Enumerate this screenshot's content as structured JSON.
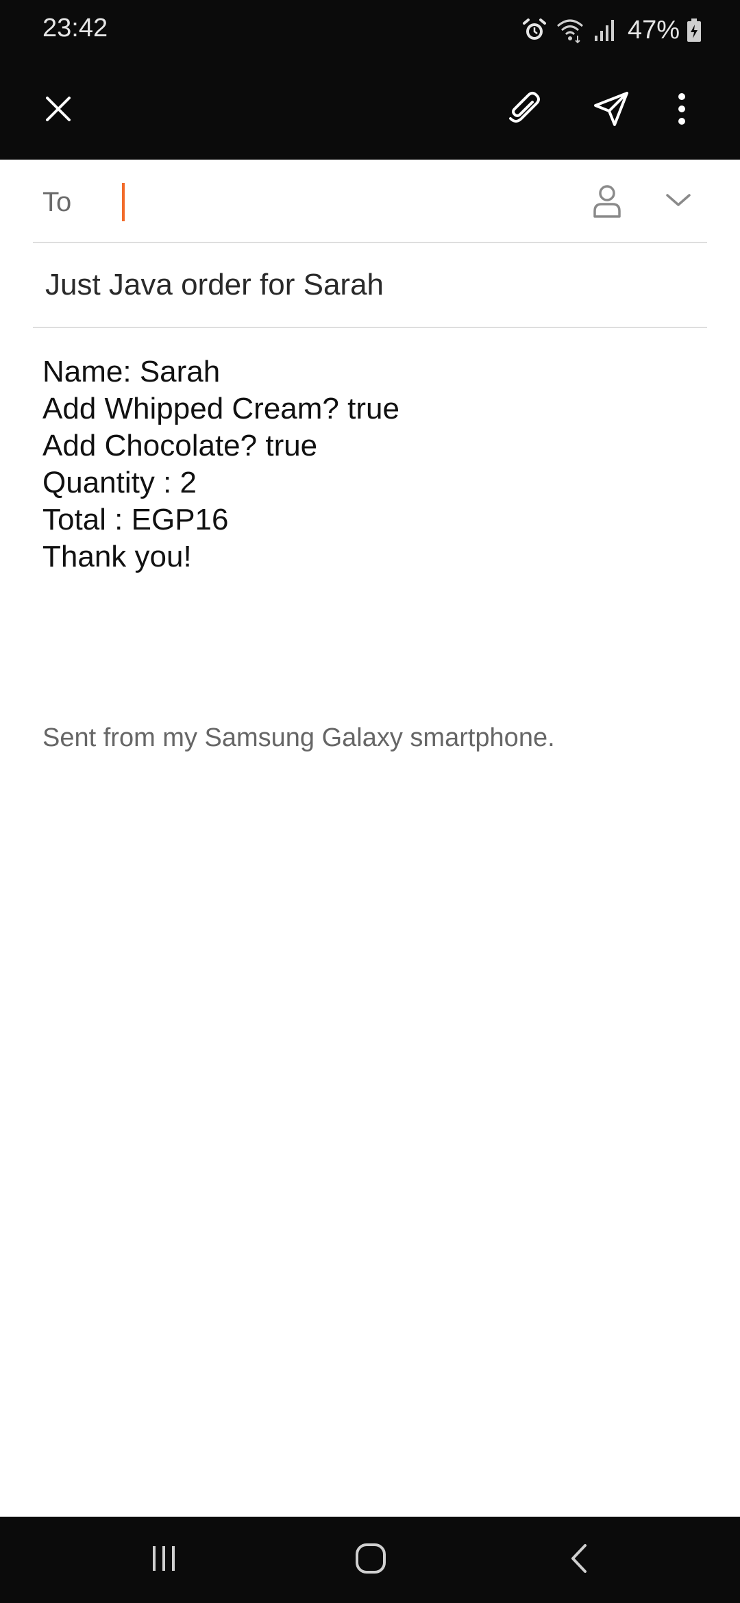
{
  "status_bar": {
    "time": "23:42",
    "battery": "47%",
    "icons": [
      "alarm-icon",
      "wifi-icon",
      "signal-icon",
      "battery-charging-icon"
    ]
  },
  "toolbar": {
    "icons": [
      "close-icon",
      "attach-icon",
      "send-icon",
      "more-vert-icon"
    ]
  },
  "compose": {
    "to_label": "To",
    "to_value": "",
    "subject": "Just Java order for Sarah",
    "body_lines": [
      "Name: Sarah",
      "Add Whipped Cream? true",
      "Add Chocolate? true",
      "Quantity : 2",
      "Total : EGP16",
      "Thank you!"
    ],
    "signature": "Sent from my Samsung Galaxy smartphone."
  },
  "nav_bar": {
    "icons": [
      "recents-icon",
      "home-icon",
      "back-icon"
    ]
  },
  "colors": {
    "bar_bg": "#0b0b0b",
    "accent_cursor": "#f26b2a",
    "divider": "#dedede"
  }
}
